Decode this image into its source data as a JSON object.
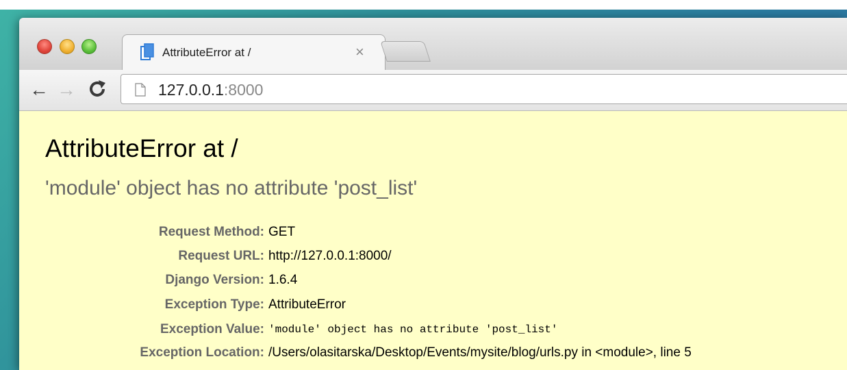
{
  "browser": {
    "tab": {
      "title": "AttributeError at /",
      "close_glyph": "×"
    },
    "toolbar": {
      "back_glyph": "←",
      "forward_glyph": "→"
    },
    "address": {
      "host": "127.0.0.1",
      "port": ":8000"
    }
  },
  "page": {
    "title": "AttributeError at /",
    "subtitle": "'module' object has no attribute 'post_list'",
    "meta": [
      {
        "label": "Request Method:",
        "value": "GET"
      },
      {
        "label": "Request URL:",
        "value": "http://127.0.0.1:8000/"
      },
      {
        "label": "Django Version:",
        "value": "1.6.4"
      },
      {
        "label": "Exception Type:",
        "value": "AttributeError"
      },
      {
        "label": "Exception Value:",
        "value": "'module' object has no attribute 'post_list'"
      },
      {
        "label": "Exception Location:",
        "value": "/Users/olasitarska/Desktop/Events/mysite/blog/urls.py in <module>, line 5"
      }
    ]
  },
  "icons": [
    "close-window-icon",
    "minimize-window-icon",
    "zoom-window-icon",
    "tab-favicon-icon",
    "back-arrow-icon",
    "forward-arrow-icon",
    "reload-icon",
    "page-icon"
  ],
  "colors": {
    "page_background": "#ffffc8",
    "subtitle": "#666666",
    "label": "#666666"
  }
}
